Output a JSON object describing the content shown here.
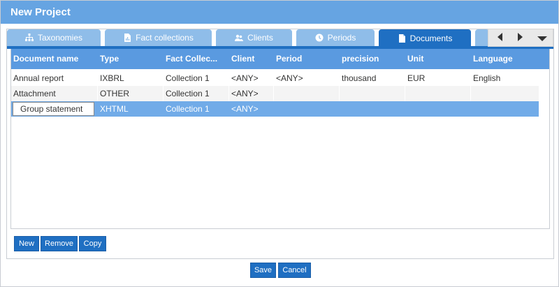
{
  "window": {
    "title": "New Project"
  },
  "tabs": [
    {
      "label": "Taxonomies",
      "icon": "hierarchy-icon"
    },
    {
      "label": "Fact collections",
      "icon": "document-chart-icon"
    },
    {
      "label": "Clients",
      "icon": "users-icon"
    },
    {
      "label": "Periods",
      "icon": "clock-icon"
    },
    {
      "label": "Documents",
      "icon": "document-icon",
      "active": true
    }
  ],
  "table": {
    "columns": [
      "Document name",
      "Type",
      "Fact Collec...",
      "Client",
      "Period",
      "precision",
      "Unit",
      "Language"
    ],
    "rows": [
      {
        "name": "Annual report",
        "type": "IXBRL",
        "fact": "Collection 1",
        "client": "<ANY>",
        "period": "<ANY>",
        "precision": "thousand",
        "unit": "EUR",
        "language": "English"
      },
      {
        "name": "Attachment",
        "type": "OTHER",
        "fact": "Collection 1",
        "client": "<ANY>",
        "period": "",
        "precision": "",
        "unit": "",
        "language": ""
      },
      {
        "name": "Group statement",
        "type": "XHTML",
        "fact": "Collection 1",
        "client": "<ANY>",
        "period": "",
        "precision": "",
        "unit": "",
        "language": "",
        "selected": true,
        "editing": true
      }
    ]
  },
  "actions": {
    "new": "New",
    "remove": "Remove",
    "copy": "Copy"
  },
  "footer": {
    "save": "Save",
    "cancel": "Cancel"
  },
  "colors": {
    "titlebar": "#66a4e2",
    "accent": "#1f6fc2",
    "header": "#5a9ae0",
    "selected_row": "#71abe8",
    "tab_inactive": "#8fbde9"
  }
}
